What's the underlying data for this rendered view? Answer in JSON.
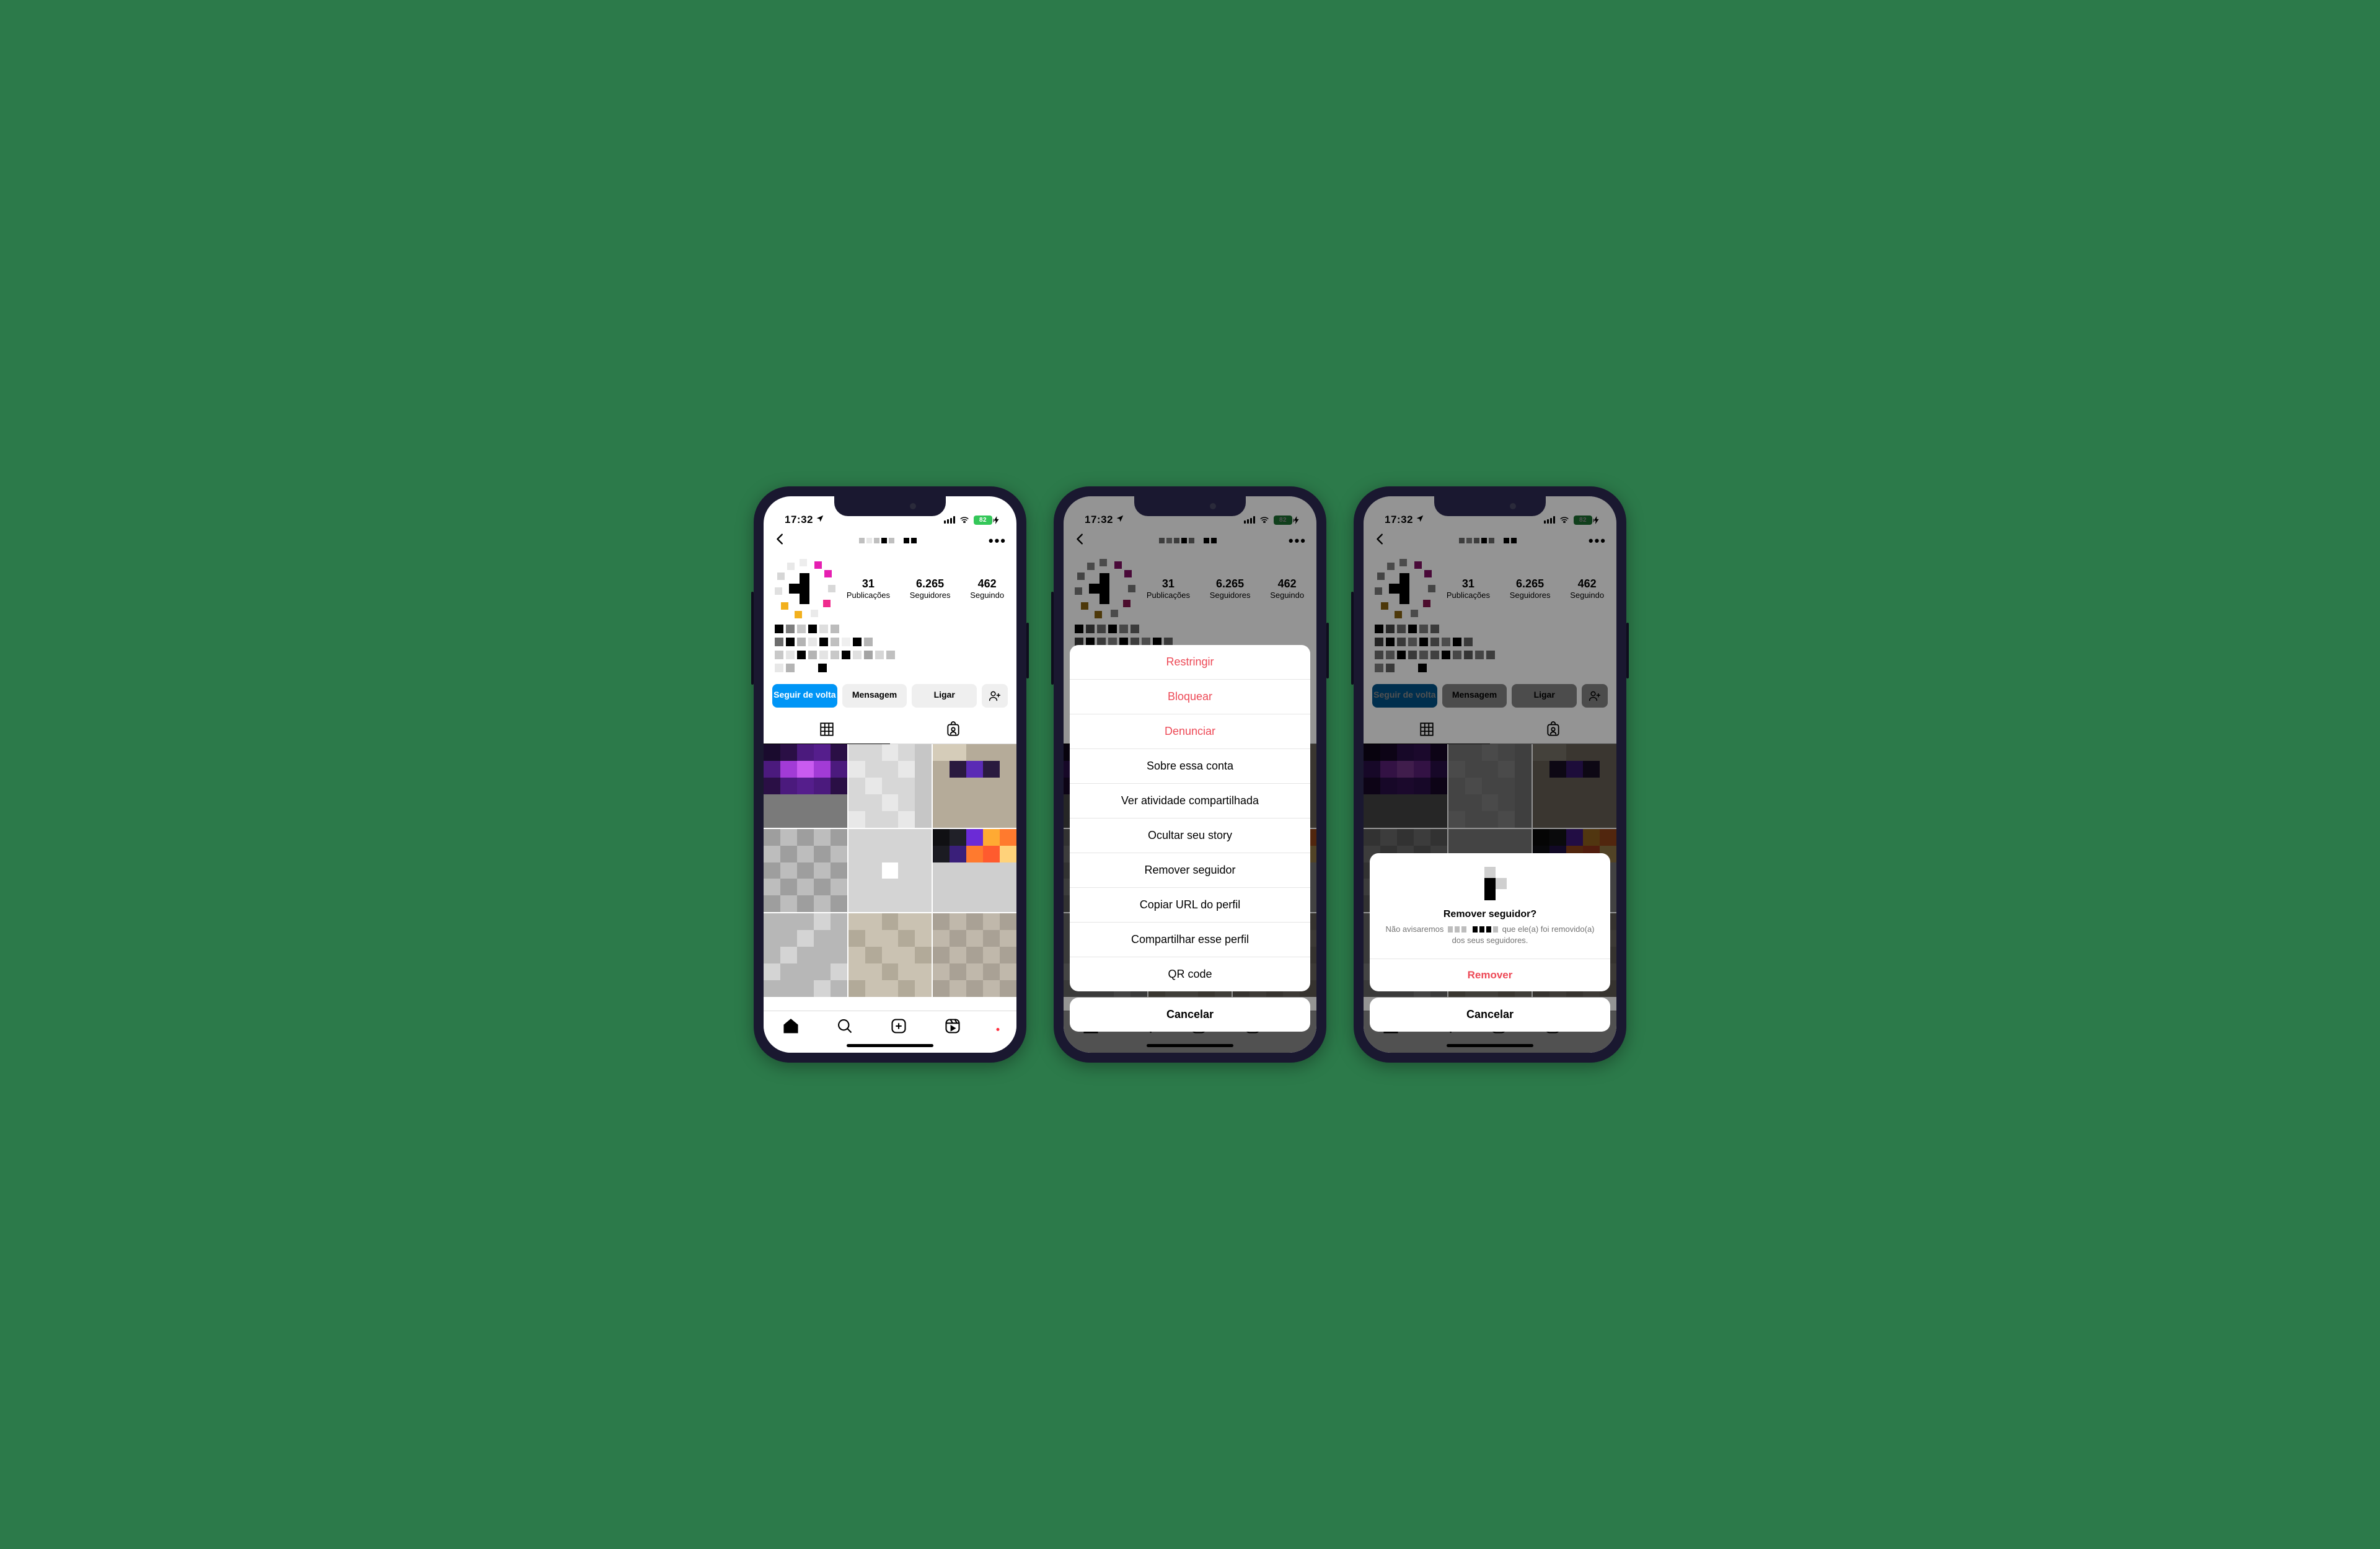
{
  "status": {
    "time": "17:32",
    "battery": "82"
  },
  "profile": {
    "username_redacted": true,
    "stats": {
      "posts": {
        "num": "31",
        "label": "Publicações"
      },
      "followers": {
        "num": "6.265",
        "label": "Seguidores"
      },
      "following": {
        "num": "462",
        "label": "Seguindo"
      }
    },
    "actions": {
      "follow_back": "Seguir de volta",
      "message": "Mensagem",
      "call": "Ligar"
    }
  },
  "action_sheet": {
    "items": [
      {
        "label": "Restringir",
        "danger": true
      },
      {
        "label": "Bloquear",
        "danger": true
      },
      {
        "label": "Denunciar",
        "danger": true
      },
      {
        "label": "Sobre essa conta",
        "danger": false
      },
      {
        "label": "Ver atividade compartilhada",
        "danger": false
      },
      {
        "label": "Ocultar seu story",
        "danger": false
      },
      {
        "label": "Remover seguidor",
        "danger": false
      },
      {
        "label": "Copiar URL do perfil",
        "danger": false
      },
      {
        "label": "Compartilhar esse perfil",
        "danger": false
      },
      {
        "label": "QR code",
        "danger": false
      }
    ],
    "cancel": "Cancelar"
  },
  "confirm": {
    "title": "Remover seguidor?",
    "body_prefix": "Não avisaremos",
    "body_suffix": " que ele(a) foi removido(a) dos seus seguidores.",
    "remove": "Remover",
    "cancel": "Cancelar"
  }
}
